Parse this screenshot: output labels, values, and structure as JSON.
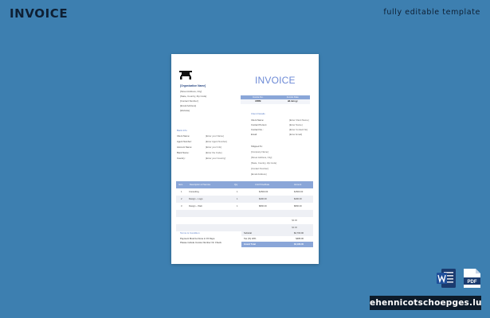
{
  "page": {
    "title": "INVOICE",
    "tagline": "fully editable template",
    "brand": "ehennicotschoepges.lu"
  },
  "colors": {
    "background": "#3d7fb0",
    "accent": "#8aa6d8",
    "invoice_title": "#6d8ad6",
    "dark": "#0d1b2a"
  },
  "file_icons": [
    "word-icon",
    "pdf-icon"
  ],
  "invoice": {
    "title": "INVOICE",
    "organization": "[Organization Name]",
    "address_lines": [
      "[Street Address, City]",
      "[State, Country, Zip Code]",
      "[Contact Number]",
      "[Email Address]",
      "[Website]"
    ],
    "meta": {
      "headers": [
        "Invoice No.",
        "Invoice Date"
      ],
      "values": [
        "##RM",
        "dd-mm-yy"
      ]
    },
    "bank": {
      "label": "Bank Info",
      "rows": [
        {
          "label": "Client Name:",
          "value": "[Enter your Name]"
        },
        {
          "label": "Agent Number:",
          "value": "[Enter Agent Number]"
        },
        {
          "label": "Account Name:",
          "value": "[Enter your Info]"
        },
        {
          "label": "Bank Name:",
          "value": "[Enter the Code]"
        },
        {
          "label": "Country:",
          "value": "[Enter your Country]"
        }
      ]
    },
    "client": {
      "label": "Client Details",
      "rows": [
        {
          "label": "Client Name:",
          "value": "[Enter Client Name]"
        },
        {
          "label": "Contact Person:",
          "value": "[Enter Name]"
        },
        {
          "label": "Contact No.:",
          "value": "[Enter Contact No]"
        },
        {
          "label": "Email:",
          "value": "[Enter Email]"
        }
      ],
      "ship_lines": [
        "Shipped To:",
        "[Company Name]",
        "[Street Address, City]",
        "[State, Country, Zip Code]",
        "[Contact Number]",
        "[Email Address]"
      ]
    },
    "lines": {
      "headers": [
        "Item",
        "Description of Service",
        "Qty",
        "Unit Price/Rate",
        "Amount"
      ],
      "rows": [
        {
          "no": "1",
          "desc": "Consulting",
          "qty": "1",
          "price": "$1500.00",
          "amount": "$1500.00"
        },
        {
          "no": "2",
          "desc": "Design – Logo",
          "qty": "1",
          "price": "$400.00",
          "amount": "$400.00"
        },
        {
          "no": "3",
          "desc": "Design – Web",
          "qty": "1",
          "price": "$800.00",
          "amount": "$800.00"
        }
      ],
      "blank_amounts": [
        "",
        "$0.00",
        "$0.00"
      ]
    },
    "terms": {
      "title": "Terms & Condition",
      "lines": [
        "Payment Must be Done in 15 Days.",
        "Please include Invoice Number On Check."
      ]
    },
    "totals": [
      {
        "label": "Subtotal",
        "value": "$2,700.00"
      },
      {
        "label": "Tax (%) 18%",
        "value": "$486.00"
      },
      {
        "label": "Grand Total",
        "value": "$3,186.00"
      }
    ]
  }
}
